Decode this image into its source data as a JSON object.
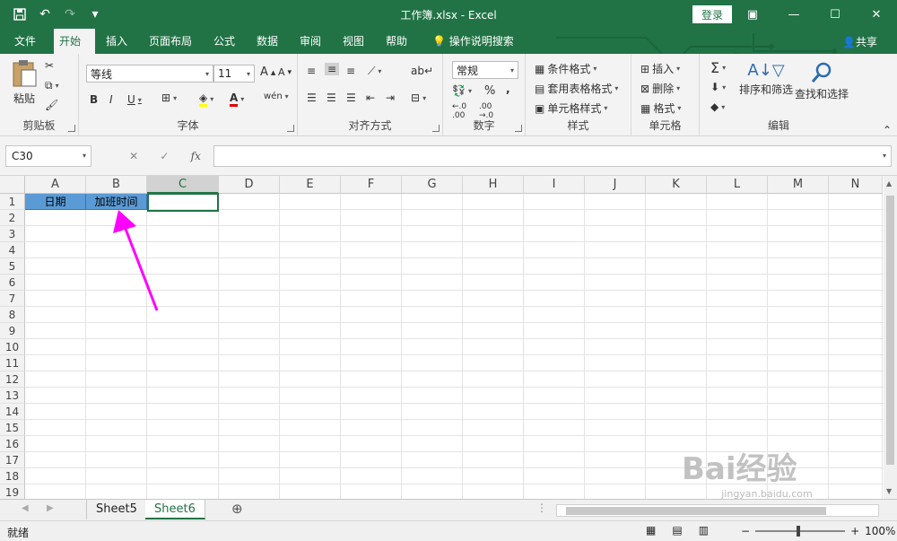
{
  "window": {
    "title": "工作簿.xlsx  -  Excel",
    "login_label": "登录",
    "share_label": "共享"
  },
  "tabs": [
    {
      "label": "文件"
    },
    {
      "label": "开始"
    },
    {
      "label": "插入"
    },
    {
      "label": "页面布局"
    },
    {
      "label": "公式"
    },
    {
      "label": "数据"
    },
    {
      "label": "审阅"
    },
    {
      "label": "视图"
    },
    {
      "label": "帮助"
    },
    {
      "label": "操作说明搜索"
    }
  ],
  "ribbon": {
    "clipboard": {
      "paste": "粘贴",
      "label": "剪贴板"
    },
    "font": {
      "name": "等线",
      "size": "11",
      "label": "字体",
      "bold": "B",
      "italic": "I",
      "underline": "U",
      "grow": "A",
      "shrink": "A",
      "color_letter": "A",
      "phonetic": "wén"
    },
    "alignment": {
      "label": "对齐方式"
    },
    "number": {
      "format": "常规",
      "label": "数字",
      "percent": "%",
      "comma": ","
    },
    "styles": {
      "conditional": "条件格式",
      "table": "套用表格格式",
      "cell": "单元格样式",
      "label": "样式"
    },
    "cells": {
      "insert": "插入",
      "delete": "删除",
      "format": "格式",
      "label": "单元格"
    },
    "editing": {
      "sort": "排序和筛选",
      "find": "查找和选择",
      "label": "编辑"
    }
  },
  "formula_bar": {
    "name_box": "C30",
    "fx": "fx",
    "value": ""
  },
  "columns": [
    "A",
    "B",
    "C",
    "D",
    "E",
    "F",
    "G",
    "H",
    "I",
    "J",
    "K",
    "L",
    "M",
    "N"
  ],
  "rows": [
    "1",
    "2",
    "3",
    "4",
    "5",
    "6",
    "7",
    "8",
    "9",
    "10",
    "11",
    "12",
    "13",
    "14",
    "15",
    "16",
    "17",
    "18",
    "19"
  ],
  "cells": {
    "A1": "日期",
    "B1": "加班时间"
  },
  "sheets": [
    {
      "name": "Sheet5"
    },
    {
      "name": "Sheet6"
    }
  ],
  "status": {
    "ready": "就绪",
    "zoom": "100%"
  },
  "watermark": {
    "brand": "Bai经验",
    "url": "jingyan.baidu.com"
  },
  "colors": {
    "accent": "#217346",
    "header_fill": "#5b9bd5",
    "arrow": "#ff00ff"
  }
}
